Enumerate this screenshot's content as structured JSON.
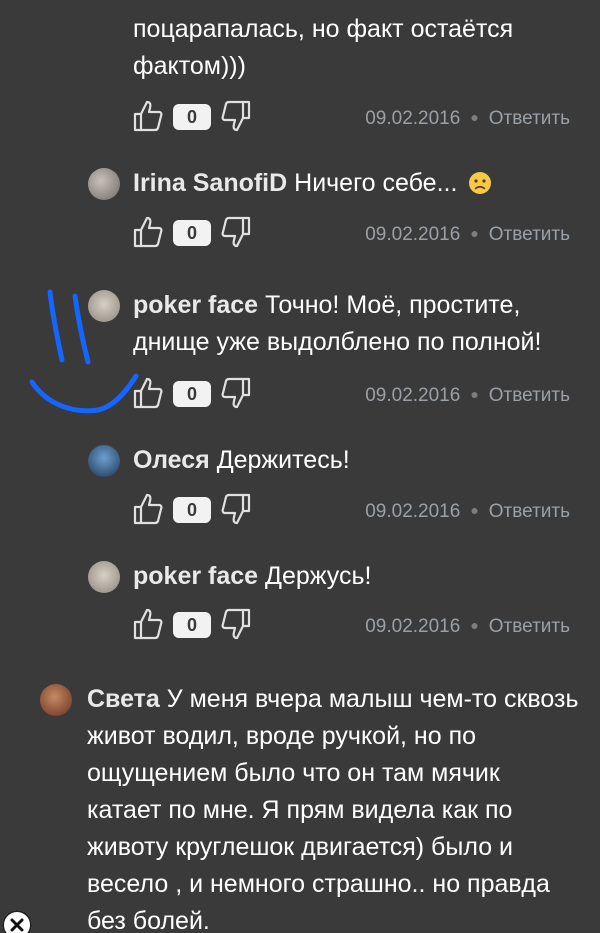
{
  "top_fragment": {
    "line1": "поцарапалась, но факт остаётся",
    "line2": "фактом)))"
  },
  "comments": [
    {
      "author": "",
      "text": "",
      "likes": "0",
      "date": "09.02.2016",
      "reply": "Ответить"
    },
    {
      "author": "Irina SanofiD",
      "text": "Ничего себе...",
      "likes": "0",
      "date": "09.02.2016",
      "reply": "Ответить"
    },
    {
      "author": "poker face",
      "text": "Точно! Моё, простите, днище уже выдолблено по полной!",
      "likes": "0",
      "date": "09.02.2016",
      "reply": "Ответить"
    },
    {
      "author": "Олеся",
      "text": "Держитесь!",
      "likes": "0",
      "date": "09.02.2016",
      "reply": "Ответить"
    },
    {
      "author": "poker face",
      "text": "Держусь!",
      "likes": "0",
      "date": "09.02.2016",
      "reply": "Ответить"
    },
    {
      "author": "Света",
      "text": "У меня вчера малыш чем-то сквозь живот водил, вроде ручкой, но по ощущением было что он там мячик катает по мне. Я прям видела как по животу круглешок двигается) было и весело , и немного страшно.. но правда без болей."
    }
  ],
  "colors": {
    "background": "#3a3a3a",
    "text": "#ffffff",
    "meta": "#9aa0a6",
    "badge": "#f2f2f2",
    "scribble": "#1565ff"
  },
  "icons": {
    "like": "thumbs-up-icon",
    "dislike": "thumbs-down-icon",
    "close": "close-icon",
    "emoji": "worried-face-emoji-icon"
  }
}
